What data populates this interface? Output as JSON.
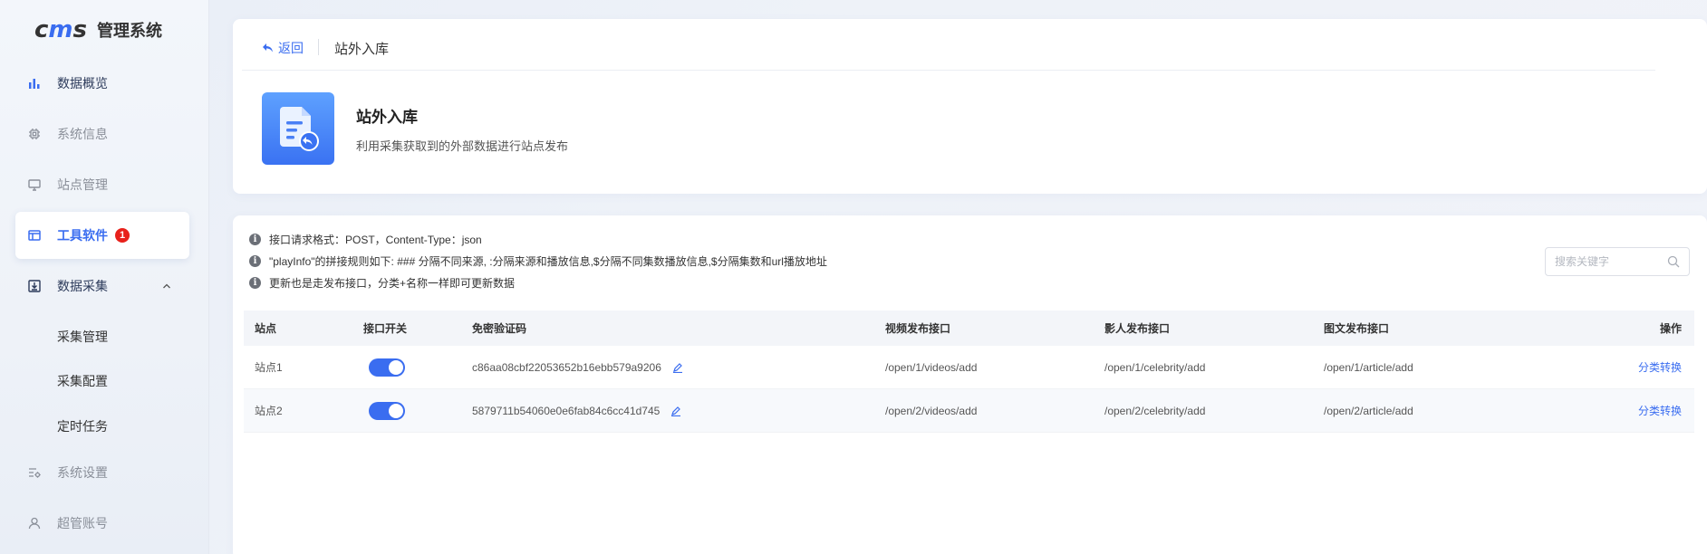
{
  "brand": {
    "logo_left": "c",
    "logo_mid": "m",
    "logo_right": "s",
    "title": "管理系统"
  },
  "sidebar": {
    "items": [
      {
        "label": "数据概览",
        "icon": "bar-chart-icon"
      },
      {
        "label": "系统信息",
        "icon": "chip-icon"
      },
      {
        "label": "站点管理",
        "icon": "monitor-icon"
      },
      {
        "label": "工具软件",
        "icon": "window-icon",
        "badge": "1"
      },
      {
        "label": "数据采集",
        "icon": "import-icon"
      },
      {
        "label": "系统设置",
        "icon": "settings-list-icon"
      },
      {
        "label": "超管账号",
        "icon": "user-icon"
      }
    ],
    "sub_items": [
      {
        "label": "采集管理"
      },
      {
        "label": "采集配置"
      },
      {
        "label": "定时任务"
      }
    ]
  },
  "header": {
    "back_label": "返回",
    "crumb": "站外入库",
    "app_title": "站外入库",
    "app_desc": "利用采集获取到的外部数据进行站点发布"
  },
  "tips": [
    "接口请求格式：POST，Content-Type：json",
    "\"playInfo\"的拼接规则如下: ### 分隔不同来源, :分隔来源和播放信息,$分隔不同集数播放信息,$分隔集数和url播放地址",
    "更新也是走发布接口，分类+名称一样即可更新数据"
  ],
  "search": {
    "placeholder": "搜索关键字"
  },
  "table": {
    "headers": [
      "站点",
      "接口开关",
      "免密验证码",
      "视频发布接口",
      "影人发布接口",
      "图文发布接口",
      "操作"
    ],
    "rows": [
      {
        "site": "站点1",
        "enabled": true,
        "code": "c86aa08cbf22053652b16ebb579a9206",
        "video_api": "/open/1/videos/add",
        "celebrity_api": "/open/1/celebrity/add",
        "article_api": "/open/1/article/add",
        "action": "分类转换"
      },
      {
        "site": "站点2",
        "enabled": true,
        "code": "5879711b54060e0e6fab84c6cc41d745",
        "video_api": "/open/2/videos/add",
        "celebrity_api": "/open/2/celebrity/add",
        "article_api": "/open/2/article/add",
        "action": "分类转换"
      }
    ]
  },
  "colors": {
    "accent": "#3a6df0",
    "badge": "#e8211b"
  }
}
